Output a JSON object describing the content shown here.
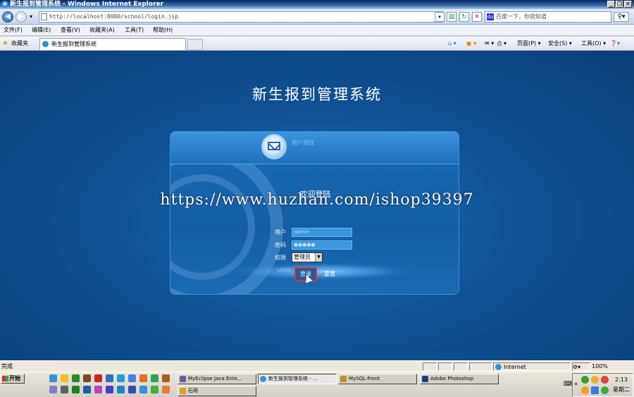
{
  "window": {
    "title": "新生报到管理系统 - Windows Internet Explorer",
    "min": "_",
    "max": "❐",
    "close": "✕"
  },
  "address": {
    "url": "http://localhost:8080/school/login.jsp",
    "search_placeholder": "百度一下，你就知道"
  },
  "menu": [
    "文件(F)",
    "编辑(E)",
    "查看(V)",
    "收藏夹(A)",
    "工具(T)",
    "帮助(H)"
  ],
  "favorites": {
    "label": "收藏夹",
    "tab_title": "新生报到管理系统"
  },
  "commands": [
    "页面(P) ▾",
    "安全(S) ▾",
    "工具(O) ▾"
  ],
  "page": {
    "system_title": "新生报到管理系统",
    "badge": "用户登陆",
    "welcome": "欢迎登陆",
    "user_label": "用户",
    "user_value": "admin",
    "pass_label": "密码",
    "pass_value": "●●●●●",
    "role_label": "权限",
    "role_value": "管理员",
    "login_small": "LOGIN",
    "login_button": "登录",
    "reset_button": "重置",
    "watermark": "https://www.huzhan.com/ishop39397"
  },
  "status": {
    "text": "完成",
    "zone": "Internet",
    "zoom": "100%"
  },
  "taskbar": {
    "start": "开始",
    "tasks": [
      "MyEclipse Java Ente...",
      "新生报到管理系统 - ...",
      "MySQL-Front",
      "Adobe Photoshop",
      "石雨"
    ],
    "time": "2:13",
    "weekday": "星期二"
  },
  "colors": {
    "page_bg": "#0f5294",
    "accent": "#2a7fc8",
    "login_border": "#e03030"
  }
}
